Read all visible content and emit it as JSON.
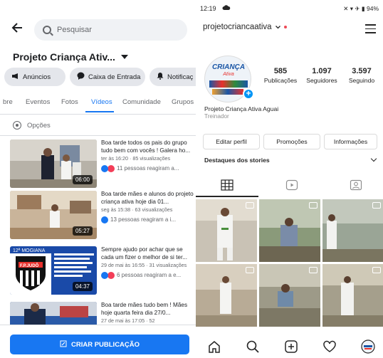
{
  "facebook": {
    "search_placeholder": "Pesquisar",
    "page_title": "Projeto Criança Ativ...",
    "pills": [
      {
        "label": "Anúncios",
        "icon": "megaphone-icon"
      },
      {
        "label": "Caixa de Entrada",
        "icon": "messenger-icon"
      },
      {
        "label": "Notificaç",
        "icon": "bell-icon"
      }
    ],
    "tabs": [
      "bre",
      "Eventos",
      "Fotos",
      "Vídeos",
      "Comunidade",
      "Grupos"
    ],
    "active_tab": "Vídeos",
    "options_label": "Opções",
    "videos": [
      {
        "title": "Boa tarde todos os pais do grupo tudo bem com vocês ! Galera ho...",
        "meta": "ter às 16:20 · 85 visualizações",
        "reactions": "11 pessoas reagiram a...",
        "duration": "06:00"
      },
      {
        "title": "Boa tarde mães e alunos do projeto criança ativa hoje dia 01...",
        "meta": "seg às 15:38 · 63 visualizações",
        "reactions": "13 pessoas reagiram a i...",
        "duration": "05:27"
      },
      {
        "title": "Sempre ajudo por achar que se cada um fizer o melhor de si ter...",
        "meta": "29 de mai às 16:55 · 31 visualizações",
        "reactions": "6 pessoas reagiram a e...",
        "duration": "04:37"
      },
      {
        "title": "Boa tarde mães tudo bem ! Mães hoje quarta feira dia 27/0...",
        "meta": "27 de mai às 17:05 · 52",
        "reactions": "",
        "duration": ""
      }
    ],
    "thumb3_text": {
      "banner": "12ª MOGIANA",
      "club": "F.P.JUDÔ"
    },
    "create_post_label": "CRIAR PUBLICAÇÃO"
  },
  "instagram": {
    "status_time": "12:19",
    "status_battery": "94%",
    "username": "projetocriancaativa",
    "avatar_text": {
      "line1": "CRIANÇA",
      "line2": "Ativa"
    },
    "stats": [
      {
        "value": "585",
        "label": "Publicações"
      },
      {
        "value": "1.097",
        "label": "Seguidores"
      },
      {
        "value": "3.597",
        "label": "Seguindo"
      }
    ],
    "bio_name": "Projeto Criança Ativa Aguai",
    "bio_category": "Treinador",
    "buttons": [
      "Editar perfil",
      "Promoções",
      "Informações"
    ],
    "highlights_label": "Destaques dos stories",
    "colors": {
      "accent": "#0095f6",
      "fb_blue": "#1877f2"
    }
  }
}
